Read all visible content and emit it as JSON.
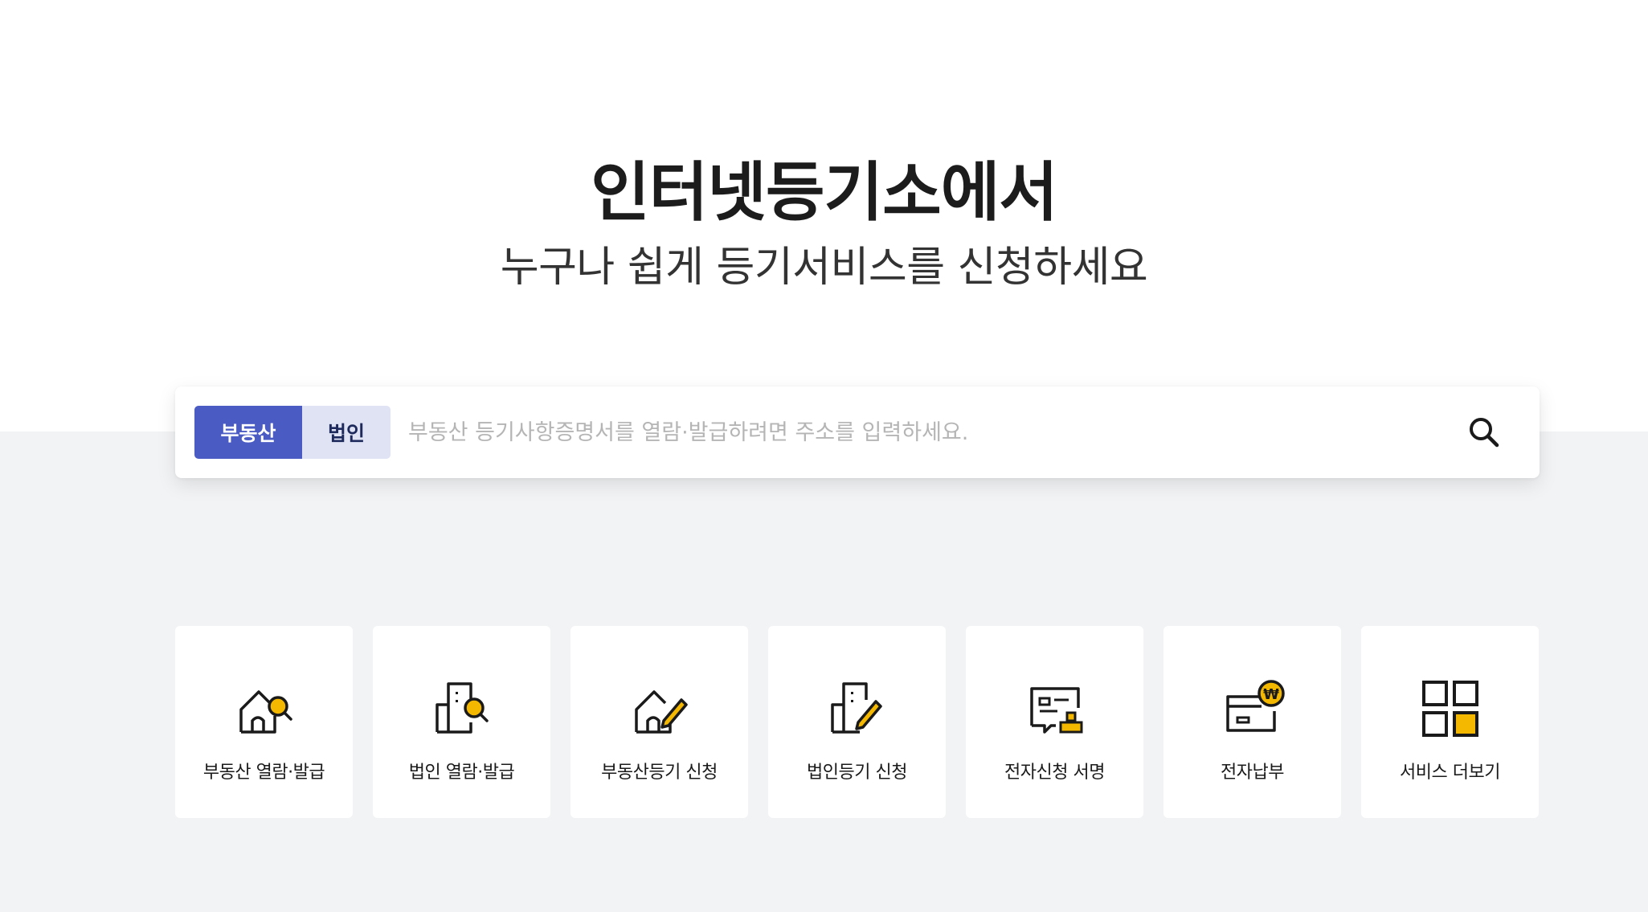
{
  "hero": {
    "title": "인터넷등기소에서",
    "subtitle": "누구나 쉽게 등기서비스를 신청하세요"
  },
  "search": {
    "tabs": [
      {
        "label": "부동산",
        "active": true
      },
      {
        "label": "법인",
        "active": false
      }
    ],
    "placeholder": "부동산 등기사항증명서를 열람·발급하려면 주소를 입력하세요.",
    "button_icon": "search-icon"
  },
  "services": [
    {
      "label": "부동산 열람·발급",
      "icon": "house-search-icon"
    },
    {
      "label": "법인 열람·발급",
      "icon": "building-search-icon"
    },
    {
      "label": "부동산등기 신청",
      "icon": "house-pen-icon"
    },
    {
      "label": "법인등기 신청",
      "icon": "building-pen-icon"
    },
    {
      "label": "전자신청 서명",
      "icon": "document-stamp-icon"
    },
    {
      "label": "전자납부",
      "icon": "card-won-icon"
    },
    {
      "label": "서비스 더보기",
      "icon": "grid-icon"
    }
  ],
  "colors": {
    "accent": "#4a5bc4",
    "tab_inactive": "#dfe3f4",
    "icon_highlight": "#f5b800",
    "background_gray": "#f2f3f5"
  }
}
